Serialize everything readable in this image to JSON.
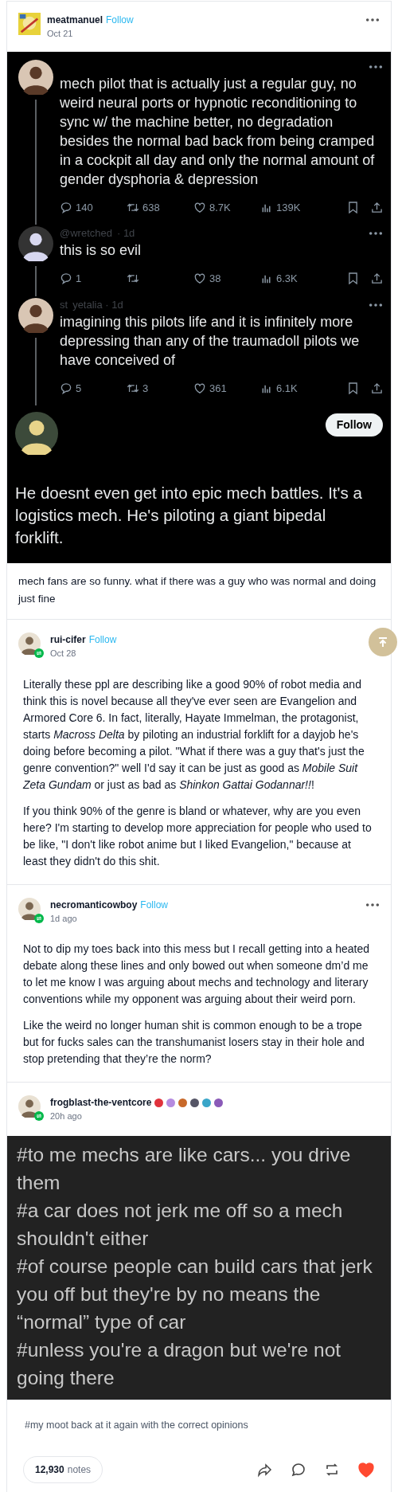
{
  "op": {
    "username": "meatmanuel",
    "follow": "Follow",
    "date": "Oct 21"
  },
  "tweets": [
    {
      "kind": "reply",
      "text": "mech pilot that is actually just a regular guy, no weird neural ports or hypnotic reconditioning to sync w/ the machine better, no degradation besides the normal bad back from being cramped in a cockpit all day and only the normal amount of gender dysphoria & depression",
      "stats": {
        "replies": "140",
        "retweets": "638",
        "likes": "8.7K",
        "views": "139K"
      },
      "thread_line": true
    },
    {
      "kind": "reply",
      "meta": [
        "@wretched",
        "· 1d"
      ],
      "text": "this is so evil",
      "stats": {
        "replies": "1",
        "likes": "38",
        "views": "6.3K"
      },
      "thread_line": true
    },
    {
      "kind": "reply",
      "meta": [
        "st",
        "yetalia · 1d"
      ],
      "text": "imagining this pilots life and it is infinitely more depressing than any of the traumadoll pilots we have conceived of",
      "stats": {
        "replies": "5",
        "retweets": "3",
        "likes": "361",
        "views": "6.1K"
      },
      "thread_line": true
    },
    {
      "kind": "quote_follow",
      "follow": "Follow",
      "text": "He doesnt even get into epic mech battles. It's a logistics mech. He's piloting a giant bipedal forklift."
    }
  ],
  "op_caption": "mech fans are so funny. what if there was a guy who was normal and doing just fine",
  "reblogs": [
    {
      "username": "rui-cifer",
      "follow": "Follow",
      "date": "Oct 28",
      "menu": false,
      "paragraphs": [
        "Literally these ppl are describing like a good 90% of robot media and think this is novel because all they've ever seen are Evangelion and Armored Core 6. In fact, literally, Hayate Immelman, the protagonist, starts *Macross Delta* by piloting an industrial forklift for a dayjob he's doing before becoming a pilot. \"What if there was a guy that's just the genre convention?\" well I'd say it can be just as good as *Mobile Suit Zeta Gundam* or just as bad as *Shinkon Gattai Godannar!!*!",
        "If you think 90% of the genre is bland or whatever, why are you even here? I'm starting to develop more appreciation for people who used to be like, \"I don't like robot anime but I liked Evangelion,\" because at least they didn't do this shit."
      ]
    },
    {
      "username": "necromanticowboy",
      "follow": "Follow",
      "date": "1d ago",
      "menu": true,
      "paragraphs": [
        "Not to dip my toes back into this mess but I recall getting into a heated debate along these lines and only bowed out when someone dm’d me to let me know I was arguing about mechs and technology and literary conventions while my opponent was arguing about their weird porn.",
        "Like the weird no longer human shit is common enough to be a trope but for fucks sales can the transhumanist losers stay in their hole and stop pretending that they’re the norm?"
      ]
    },
    {
      "username": "frogblast-the-ventcore",
      "date": "20h ago",
      "menu": false,
      "badges": [
        {
          "color": "#e0323c"
        },
        {
          "color": "#b58be0"
        },
        {
          "color": "#c8692a"
        },
        {
          "color": "#555566"
        },
        {
          "color": "#3aa6c9"
        },
        {
          "color": "#8a5ab8"
        }
      ],
      "tags": [
        "#to me mechs are like cars... you drive them",
        "#a car does not jerk me off so a mech shouldn't either",
        "#of course people can build cars that jerk you off but they're by no means the “normal” type of car",
        "#unless you're a dragon but we're not going there"
      ]
    }
  ],
  "footer_tag": "#my moot back at it again with the correct opinions",
  "notes": {
    "count": "12,930",
    "label": "notes"
  },
  "liked": true
}
